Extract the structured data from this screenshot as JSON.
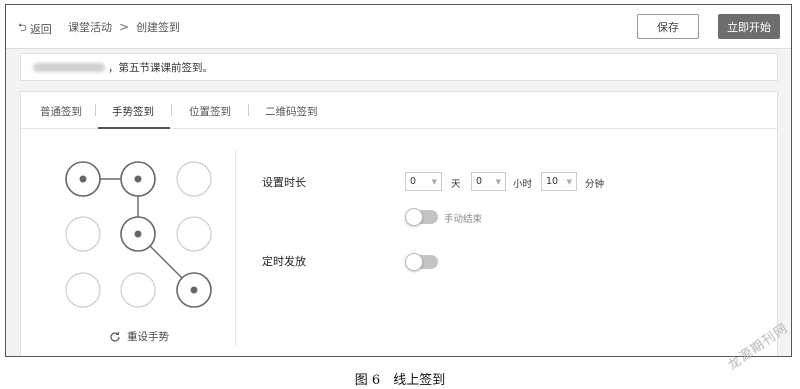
{
  "header": {
    "back_label": "返回",
    "breadcrumbs": [
      "课堂活动",
      "创建签到"
    ],
    "separator": ">",
    "save_label": "保存",
    "start_label": "立即开始"
  },
  "notice": {
    "text": "，第五节课课前签到。"
  },
  "tabs": [
    {
      "label": "普通签到",
      "active": false
    },
    {
      "label": "手势签到",
      "active": true
    },
    {
      "label": "位置签到",
      "active": false
    },
    {
      "label": "二维码签到",
      "active": false
    }
  ],
  "gesture": {
    "selected_dots": [
      1,
      2,
      5,
      9
    ],
    "reset_label": "重设手势"
  },
  "settings": {
    "duration_label": "设置时长",
    "days_value": "0",
    "days_unit": "天",
    "hours_value": "0",
    "hours_unit": "小时",
    "minutes_value": "10",
    "minutes_unit": "分钟",
    "manual_end_label": "手动结束",
    "scheduled_label": "定时发放"
  },
  "caption": "图 6　线上签到",
  "watermark": "龙源期刊网",
  "colors": {
    "primary_button": "#6e6e6e",
    "toggle_off": "#c4c4c4"
  }
}
